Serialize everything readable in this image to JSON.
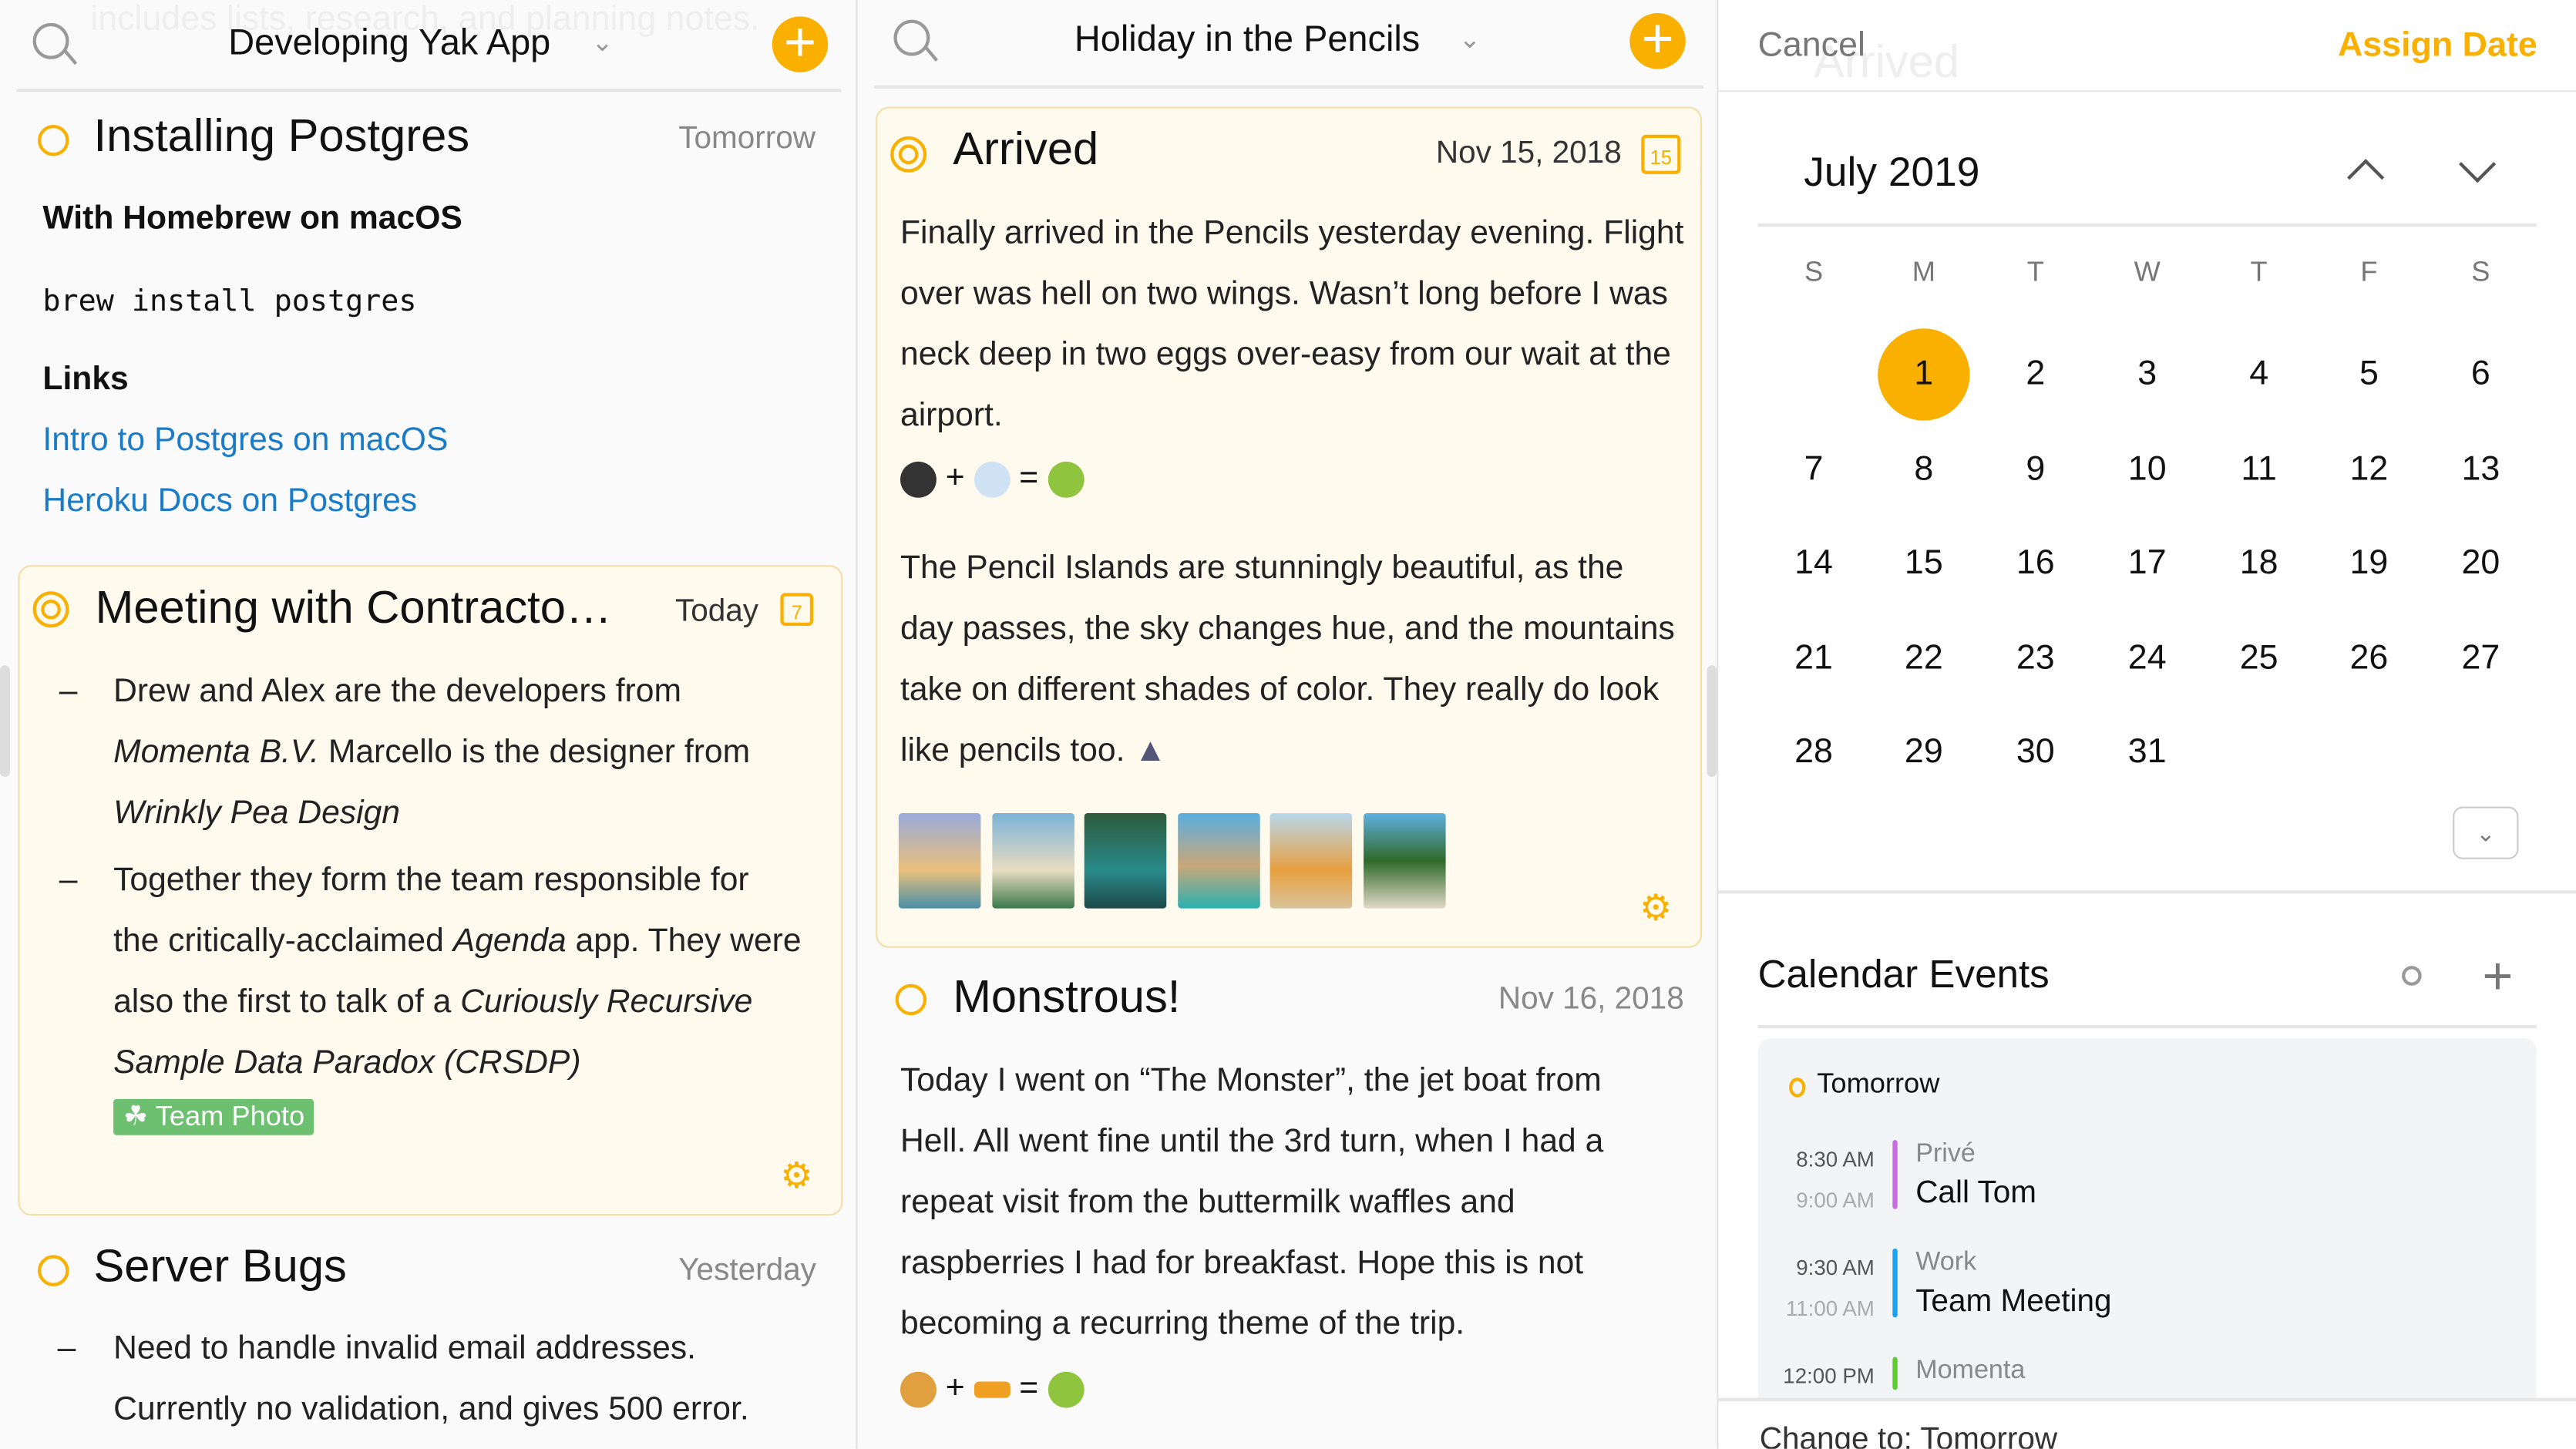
{
  "left": {
    "ghost_text": "includes lists, research, and planning notes.",
    "title": "Developing Yak App",
    "notes": [
      {
        "title": "Installing Postgres",
        "date": "Tomorrow",
        "heading": "With Homebrew on macOS",
        "code": "brew install postgres",
        "links_heading": "Links",
        "links": [
          "Intro to Postgres on macOS",
          "Heroku Docs on Postgres"
        ]
      },
      {
        "title": "Meeting with Contracto…",
        "date": "Today",
        "badge": "7",
        "bullets": [
          {
            "a": "Drew and Alex are the developers from ",
            "i1": "Momenta B.V.",
            "b": " Marcello is the designer from ",
            "i2": "Wrinkly Pea Design"
          },
          {
            "a": "Together they form the team responsible for the critically-acclaimed ",
            "i1": "Agenda",
            "b": " app. They were also the first to talk of a ",
            "i2": "Curiously Recursive Sample Data Paradox (CRSDP)"
          }
        ],
        "tag": "Team Photo"
      },
      {
        "title": "Server Bugs",
        "date": "Yesterday",
        "bullet": "Need to handle invalid email addresses. Currently no validation, and gives 500 error."
      }
    ]
  },
  "middle": {
    "title": "Holiday in the Pencils",
    "notes": [
      {
        "title": "Arrived",
        "date": "Nov 15, 2018",
        "badge": "15",
        "p1": "Finally arrived in the Pencils yesterday evening. Flight over was hell on two wings. Wasn’t long before I was neck deep in two eggs over-easy from our wait at the airport.",
        "p2": "The Pencil Islands are stunningly beautiful, as the day passes, the sky changes hue, and the mountains take on different shades of color. They really do look like pencils too.",
        "photos": 6
      },
      {
        "title": "Monstrous!",
        "date": "Nov 16, 2018",
        "p1": "Today I went on “The Monster”, the jet boat from Hell. All went fine until the 3rd turn, when I had a repeat visit from the buttermilk waffles and raspberries I had for breakfast. Hope this is not becoming a recurring theme of the trip."
      }
    ],
    "equation": {
      "plus": "+",
      "equals": "="
    }
  },
  "right": {
    "cancel": "Cancel",
    "assign": "Assign Date",
    "ghost": "Arrived",
    "month": "July 2019",
    "weekdays": [
      "S",
      "M",
      "T",
      "W",
      "T",
      "F",
      "S"
    ],
    "first_weekday": 1,
    "days_in_month": 31,
    "selected_day": 1,
    "events_title": "Calendar Events",
    "events_day": "Tomorrow",
    "events": [
      {
        "start": "8:30 AM",
        "end": "9:00 AM",
        "calendar": "Privé",
        "title": "Call Tom",
        "color": "#c86ee0"
      },
      {
        "start": "9:30 AM",
        "end": "11:00 AM",
        "calendar": "Work",
        "title": "Team Meeting",
        "color": "#1aa3f0"
      },
      {
        "start": "12:00 PM",
        "end": "",
        "calendar": "Momenta",
        "title": "",
        "color": "#5ccc33"
      }
    ],
    "change_to": "Change to: Tomorrow"
  },
  "colors": {
    "accent": "#f9b000",
    "link": "#1a7cc9",
    "card_bg": "#fffaee"
  }
}
